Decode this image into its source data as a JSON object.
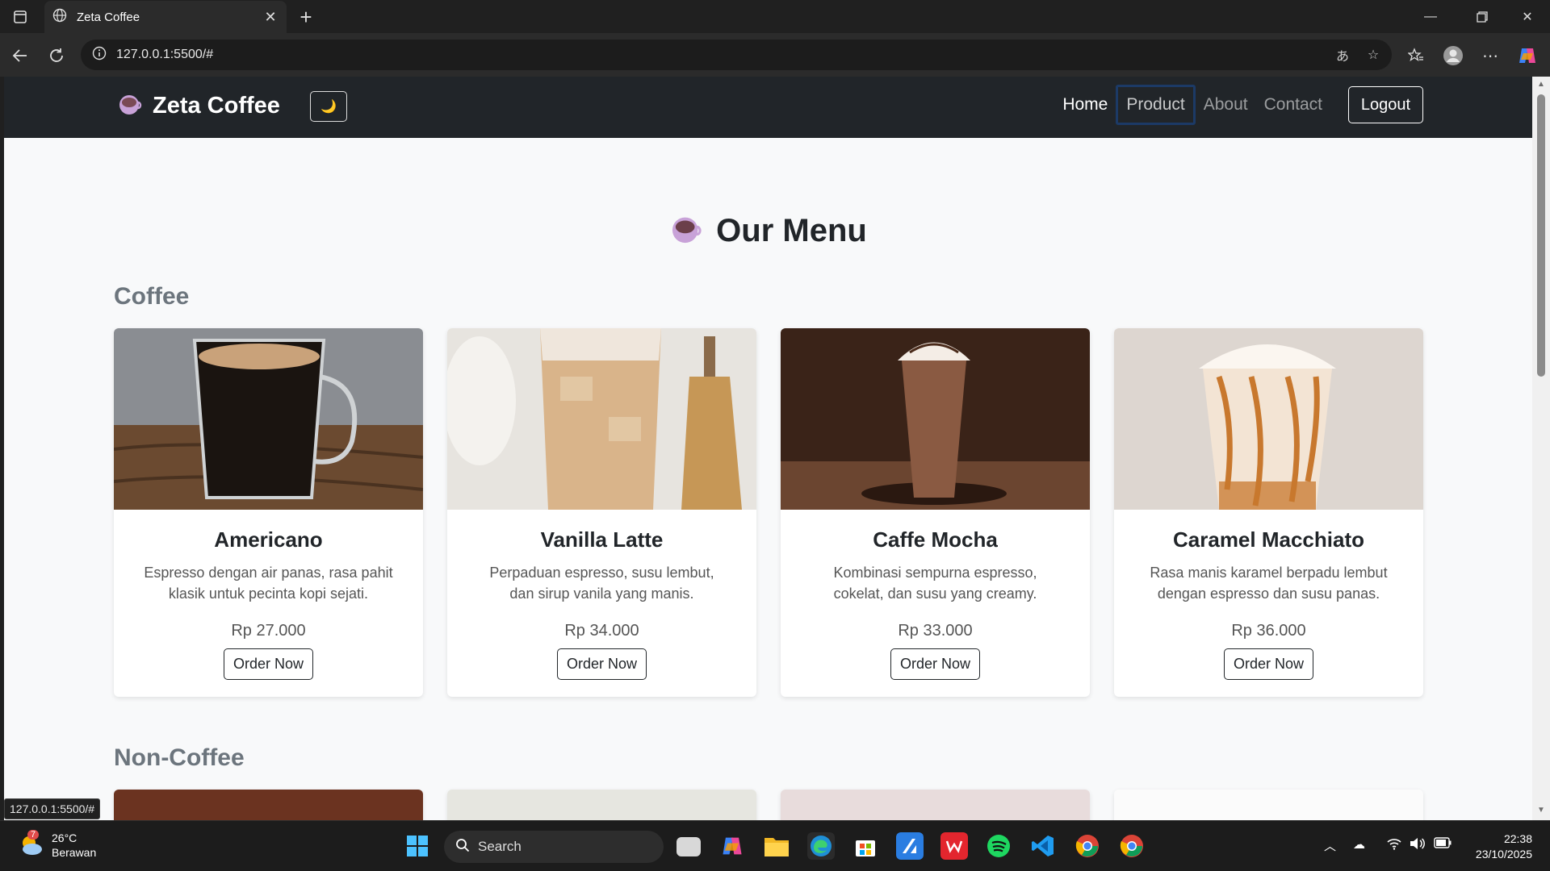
{
  "browser": {
    "tab_title": "Zeta Coffee",
    "url": "127.0.0.1:5500/#",
    "status_url": "127.0.0.1:5500/#"
  },
  "site": {
    "brand": "Zeta Coffee",
    "theme_toggle_icon": "🌙",
    "nav": [
      "Home",
      "Product",
      "About",
      "Contact"
    ],
    "logout": "Logout"
  },
  "menu": {
    "title": "Our Menu",
    "sections": [
      {
        "title": "Coffee",
        "items": [
          {
            "name": "Americano",
            "desc": "Espresso dengan air panas, rasa pahit klasik untuk pecinta kopi sejati.",
            "price": "Rp 27.000",
            "button": "Order Now"
          },
          {
            "name": "Vanilla Latte",
            "desc": "Perpaduan espresso, susu lembut, dan sirup vanila yang manis.",
            "price": "Rp 34.000",
            "button": "Order Now"
          },
          {
            "name": "Caffe Mocha",
            "desc": "Kombinasi sempurna espresso, cokelat, dan susu yang creamy.",
            "price": "Rp 33.000",
            "button": "Order Now"
          },
          {
            "name": "Caramel Macchiato",
            "desc": "Rasa manis karamel berpadu lembut dengan espresso dan susu panas.",
            "price": "Rp 36.000",
            "button": "Order Now"
          }
        ]
      },
      {
        "title": "Non-Coffee"
      }
    ]
  },
  "taskbar": {
    "weather_temp": "26°C",
    "weather_desc": "Berawan",
    "weather_badge": "7",
    "search_label": "Search",
    "time": "22:38",
    "date": "23/10/2025"
  }
}
